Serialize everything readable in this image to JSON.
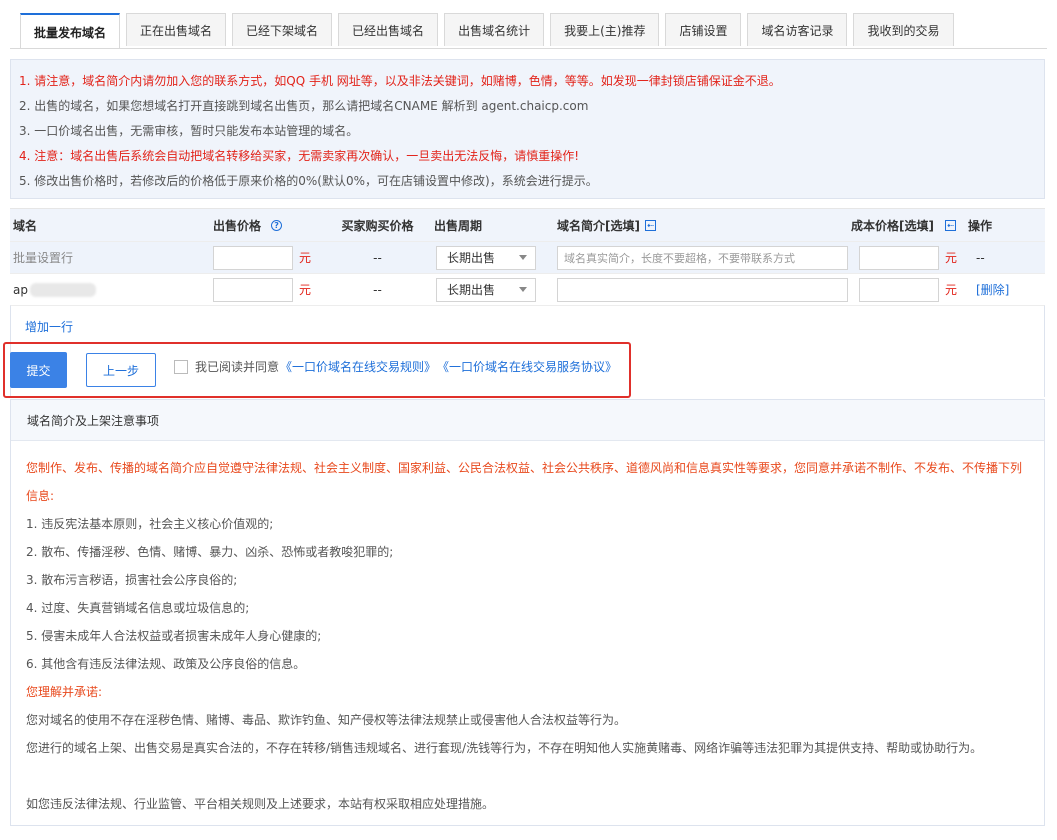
{
  "tabs": [
    {
      "label": "批量发布域名",
      "active": true
    },
    {
      "label": "正在出售域名"
    },
    {
      "label": "已经下架域名"
    },
    {
      "label": "已经出售域名"
    },
    {
      "label": "出售域名统计"
    },
    {
      "label": "我要上(主)推荐"
    },
    {
      "label": "店铺设置"
    },
    {
      "label": "域名访客记录"
    },
    {
      "label": "我收到的交易"
    }
  ],
  "notice": {
    "line1": "1. 请注意，域名简介内请勿加入您的联系方式，如QQ 手机 网址等，以及非法关键词，如赌博，色情，等等。如发现一律封锁店铺保证金不退。",
    "line2": "2. 出售的域名，如果您想域名打开直接跳到域名出售页，那么请把域名CNAME 解析到 agent.chaicp.com",
    "line3": "3. 一口价域名出售，无需审核，暂时只能发布本站管理的域名。",
    "line4": "4. 注意：域名出售后系统会自动把域名转移给买家，无需卖家再次确认，一旦卖出无法反悔，请慎重操作!",
    "line5": "5. 修改出售价格时，若修改后的价格低于原来价格的0%(默认0%，可在店铺设置中修改)，系统会进行提示。"
  },
  "table": {
    "headers": {
      "name": "域名",
      "price": "出售价格",
      "buyer_price": "买家购买价格",
      "period": "出售周期",
      "desc": "域名简介[选填]",
      "cost": "成本价格[选填]",
      "op": "操作"
    },
    "batch_row": {
      "name": "批量设置行",
      "buyer_price": "--",
      "period": "长期出售",
      "desc_placeholder": "域名真实简介，长度不要超格，不要带联系方式",
      "op": "--"
    },
    "domain_row": {
      "name": "ap",
      "buyer_price": "--",
      "period": "长期出售",
      "op": "[删除]"
    },
    "unit": "元",
    "add_row": "增加一行"
  },
  "actions": {
    "submit": "提交",
    "prev": "上一步",
    "agree_text": "我已阅读并同意",
    "rule1": "《一口价域名在线交易规则》",
    "rule2": "《一口价域名在线交易服务协议》"
  },
  "rules": {
    "title": "域名简介及上架注意事项",
    "intro1": "您制作、发布、传播的域名简介应自觉遵守法律法规、社会主义制度、国家利益、公民合法权益、社会公共秩序、道德风尚和信息真实性等要求，您同意并承诺不制作、不发布、不传播下列",
    "intro2": "信息:",
    "items": [
      "1. 违反宪法基本原则，社会主义核心价值观的;",
      "2. 散布、传播淫秽、色情、赌博、暴力、凶杀、恐怖或者教唆犯罪的;",
      "3. 散布污言秽语，损害社会公序良俗的;",
      "4. 过度、失真营销域名信息或垃圾信息的;",
      "5. 侵害未成年人合法权益或者损害未成年人身心健康的;",
      "6. 其他含有违反法律法规、政策及公序良俗的信息。"
    ],
    "promise_title": "您理解并承诺:",
    "promise1": "您对域名的使用不存在淫秽色情、赌博、毒品、欺诈钓鱼、知产侵权等法律法规禁止或侵害他人合法权益等行为。",
    "promise2": "您进行的域名上架、出售交易是真实合法的，不存在转移/销售违规域名、进行套现/洗钱等行为，不存在明知他人实施黄赌毒、网络诈骗等违法犯罪为其提供支持、帮助或协助行为。",
    "footer": "如您违反法律法规、行业监管、平台相关规则及上述要求，本站有权采取相应处理措施。"
  },
  "colors": {
    "accent": "#1e6fd9",
    "button": "#3b82e6",
    "warning_red": "#e2231a",
    "highlight_box": "#e0302b",
    "notice_bg": "#f0f4fb"
  }
}
